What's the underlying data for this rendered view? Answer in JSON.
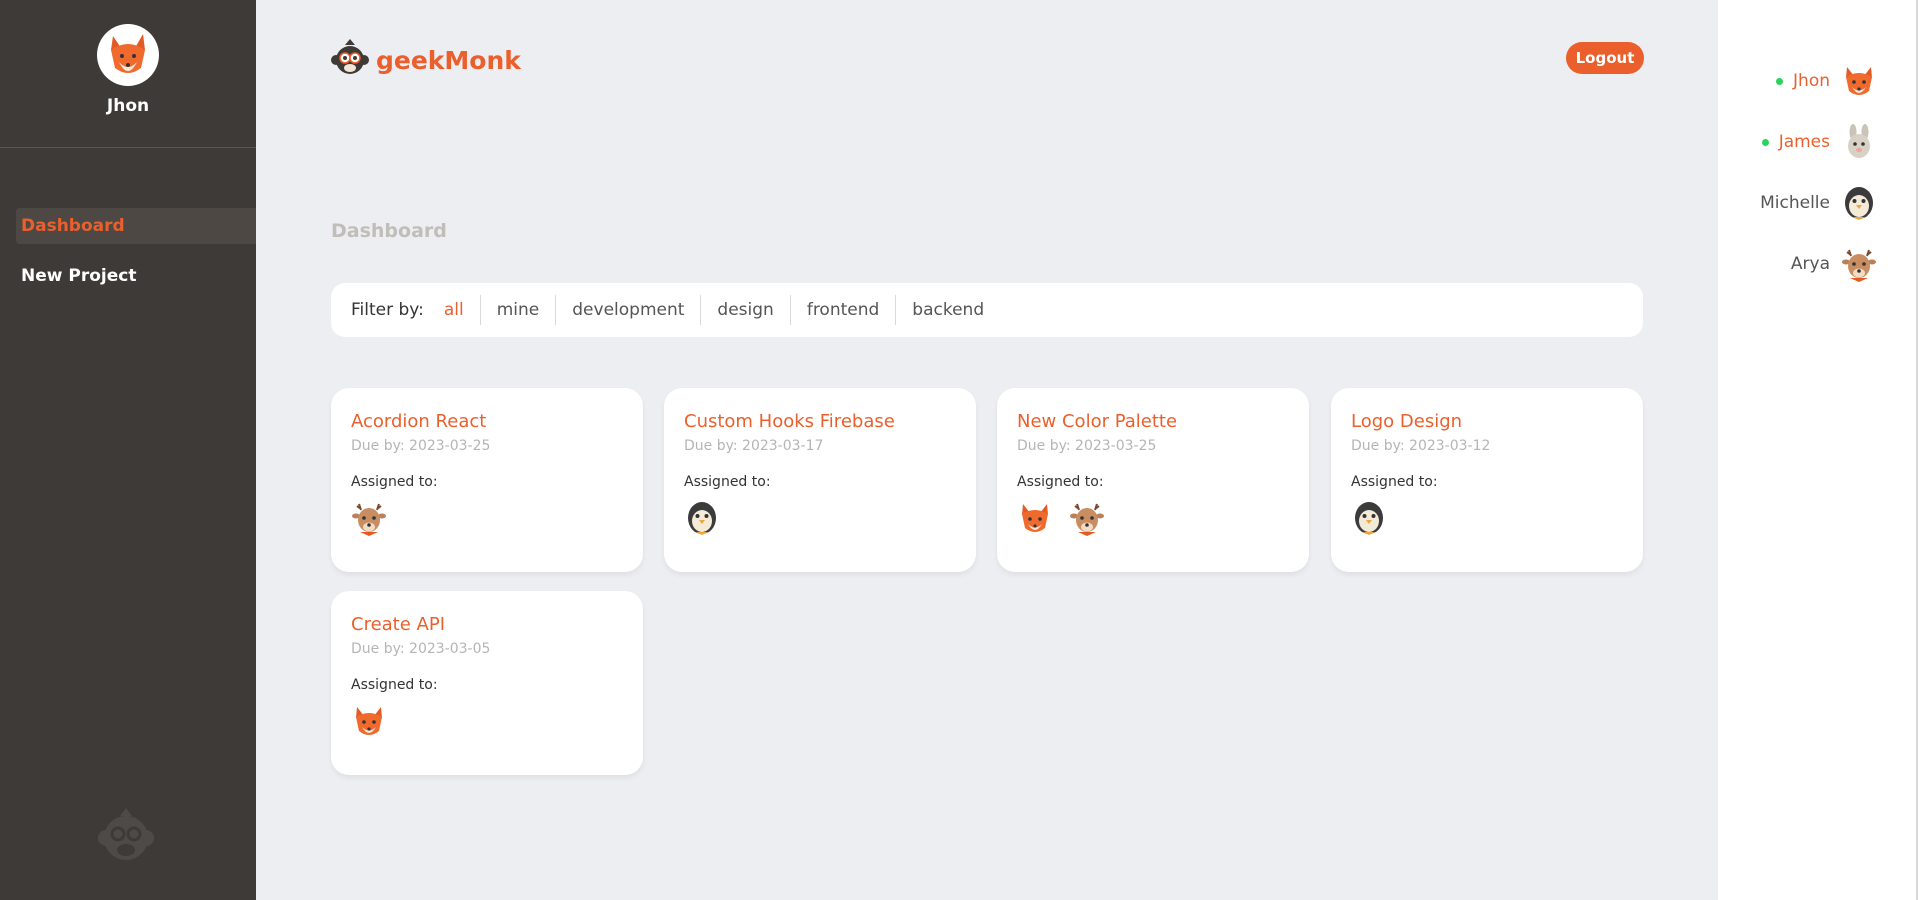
{
  "sidebar": {
    "user_name": "Jhon",
    "nav": [
      {
        "label": "Dashboard",
        "active": true
      },
      {
        "label": "New Project",
        "active": false
      }
    ]
  },
  "header": {
    "brand": "geekMonk",
    "logout_label": "Logout"
  },
  "page": {
    "title": "Dashboard"
  },
  "filter": {
    "label": "Filter by:",
    "options": [
      "all",
      "mine",
      "development",
      "design",
      "frontend",
      "backend"
    ],
    "selected": "all"
  },
  "projects": [
    {
      "title": "Acordion React",
      "due": "Due by: 2023-03-25",
      "assigned_label": "Assigned to:",
      "assignees": [
        "deer-avatar"
      ]
    },
    {
      "title": "Custom Hooks Firebase",
      "due": "Due by: 2023-03-17",
      "assigned_label": "Assigned to:",
      "assignees": [
        "penguin-avatar"
      ]
    },
    {
      "title": "New Color Palette",
      "due": "Due by: 2023-03-25",
      "assigned_label": "Assigned to:",
      "assignees": [
        "fox-avatar",
        "deer-avatar"
      ]
    },
    {
      "title": "Logo Design",
      "due": "Due by: 2023-03-12",
      "assigned_label": "Assigned to:",
      "assignees": [
        "penguin-avatar"
      ]
    },
    {
      "title": "Create API",
      "due": "Due by: 2023-03-05",
      "assigned_label": "Assigned to:",
      "assignees": [
        "fox-avatar"
      ]
    }
  ],
  "online_users": [
    {
      "name": "Jhon",
      "online": true,
      "avatar": "fox-avatar"
    },
    {
      "name": "James",
      "online": true,
      "avatar": "rabbit-avatar"
    },
    {
      "name": "Michelle",
      "online": false,
      "avatar": "penguin-avatar"
    },
    {
      "name": "Arya",
      "online": false,
      "avatar": "deer-avatar"
    }
  ],
  "colors": {
    "accent": "#eb5f2c",
    "sidebar_bg": "#3e3a37",
    "page_bg": "#edeef2",
    "online": "#2ad35a"
  }
}
